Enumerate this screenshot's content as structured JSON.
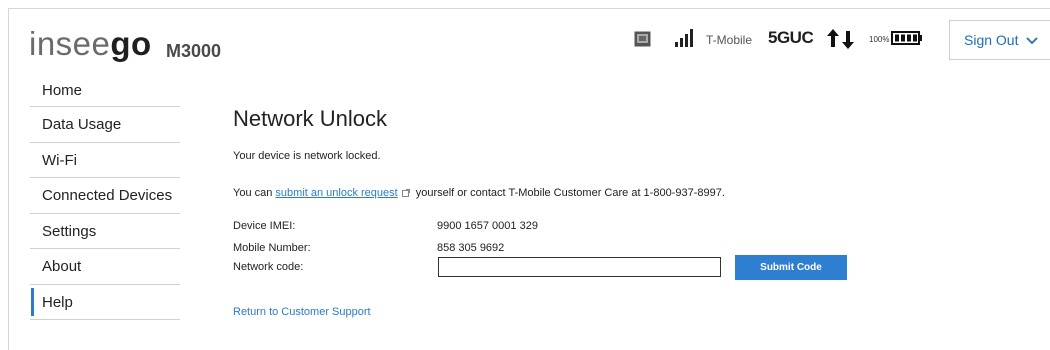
{
  "header": {
    "brand_light": "insee",
    "brand_bold": "go",
    "model": "M3000",
    "carrier": "T-Mobile",
    "network": "5GUC",
    "battery_percent": "100%",
    "signout_label": "Sign Out"
  },
  "icons": {
    "sim": "sim-card-icon",
    "signal": "signal-bars-icon",
    "data_activity": "updown-arrows-icon",
    "battery": "battery-icon",
    "chevron": "chevron-down-icon",
    "external": "external-link-icon"
  },
  "sidebar": {
    "items": [
      {
        "label": "Home"
      },
      {
        "label": "Data Usage"
      },
      {
        "label": "Wi-Fi"
      },
      {
        "label": "Connected Devices"
      },
      {
        "label": "Settings"
      },
      {
        "label": "About"
      },
      {
        "label": "Help"
      }
    ],
    "active": "Help"
  },
  "main": {
    "title": "Network Unlock",
    "locked_message": "Your device is network locked.",
    "unlock_prefix": "You can",
    "unlock_link": "submit an unlock request",
    "unlock_suffix": "yourself or contact T-Mobile Customer Care at 1-800-937-8997.",
    "imei_label": "Device IMEI:",
    "imei_value": "9900 1657 0001 329",
    "mobile_label": "Mobile Number:",
    "mobile_value": "858 305 9692",
    "code_label": "Network code:",
    "code_value": "",
    "submit_label": "Submit Code",
    "return_link": "Return to Customer Support"
  },
  "colors": {
    "accent": "#2f7fd0",
    "link": "#2b7bc8",
    "border": "#d0d0d0"
  }
}
